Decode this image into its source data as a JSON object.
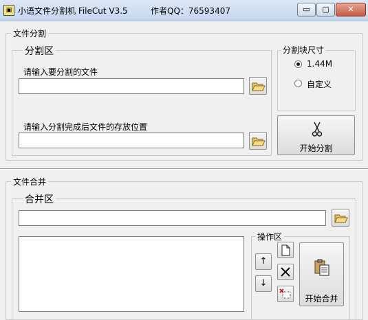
{
  "window": {
    "title": "小语文件分割机 FileCut V3.5",
    "author": "作者QQ：76593407",
    "min_label": "▭",
    "max_label": "▢",
    "close_label": "✕"
  },
  "split": {
    "group_title": "文件分割",
    "area_title": "分割区",
    "input_file_label": "请输入要分割的文件",
    "input_file_value": "",
    "output_path_label": "请输入分割完成后文件的存放位置",
    "output_path_value": "",
    "size_group_title": "分割块尺寸",
    "size_options": [
      {
        "label": "1.44M",
        "selected": true
      },
      {
        "label": "自定义",
        "selected": false
      }
    ],
    "start_button_label": "开始分割",
    "browse_icon": "open-folder-icon",
    "start_icon": "scissors-icon"
  },
  "merge": {
    "group_title": "文件合并",
    "area_title": "合并区",
    "file_value": "",
    "ops_title": "操作区",
    "up_label": "↑",
    "down_label": "↓",
    "start_button_label": "开始合并",
    "browse_icon": "open-folder-icon",
    "start_icon": "paste-icon"
  }
}
